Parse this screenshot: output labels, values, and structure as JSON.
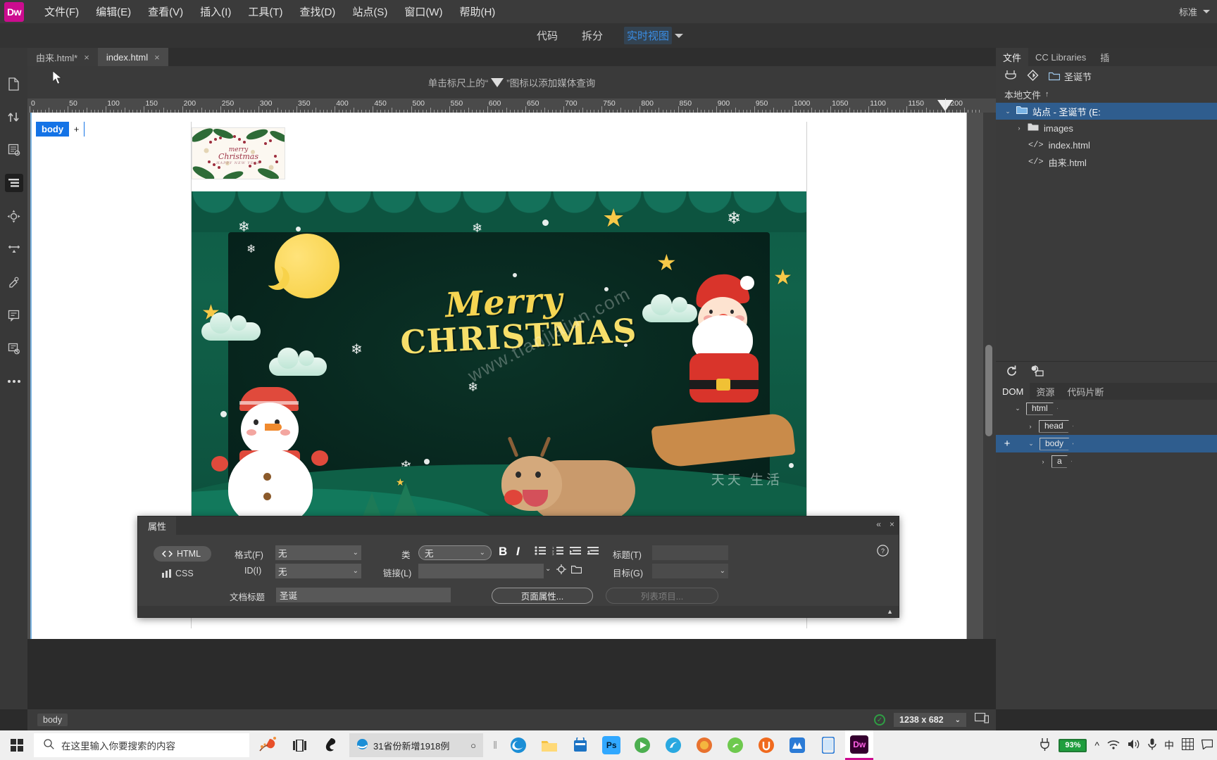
{
  "app": {
    "logo_text": "Dw",
    "workspace_label": "标准"
  },
  "menu": {
    "items": [
      {
        "label": "文件(F)"
      },
      {
        "label": "编辑(E)"
      },
      {
        "label": "查看(V)"
      },
      {
        "label": "插入(I)"
      },
      {
        "label": "工具(T)"
      },
      {
        "label": "查找(D)"
      },
      {
        "label": "站点(S)"
      },
      {
        "label": "窗口(W)"
      },
      {
        "label": "帮助(H)"
      }
    ]
  },
  "viewbar": {
    "code": "代码",
    "split": "拆分",
    "live": "实时视图"
  },
  "tabs": [
    {
      "label": "由来.html*",
      "active": false
    },
    {
      "label": "index.html",
      "active": true
    }
  ],
  "media_query_hint": {
    "before": "单击标尺上的“",
    "after": "”图标以添加媒体查询"
  },
  "ruler": {
    "labels": [
      "0",
      "50",
      "100",
      "150",
      "200",
      "250",
      "300",
      "350",
      "400",
      "450",
      "500",
      "550",
      "600",
      "650",
      "700",
      "750",
      "800",
      "850",
      "900",
      "950",
      "1000",
      "1050",
      "1100",
      "1150",
      "1200"
    ],
    "marker_position_label": "1200"
  },
  "canvas": {
    "body_badge": "body",
    "body_badge_plus": "+",
    "banner": {
      "title": "merry",
      "subtitle": "Christmas",
      "small": "HAPPY NEW YEAR"
    },
    "hero": {
      "merry": "Merry",
      "christmas": "CHRISTMAS",
      "watermark": "www.tianjiajun.com",
      "watermark2": "天天 生活"
    }
  },
  "properties": {
    "panel_title": "属性",
    "html_tab": "HTML",
    "css_tab": "CSS",
    "format_label": "格式(F)",
    "format_value": "无",
    "id_label": "ID(I)",
    "id_value": "无",
    "class_label": "类",
    "class_value": "无",
    "link_label": "链接(L)",
    "link_value": "",
    "title_label": "标题(T)",
    "title_value": "",
    "target_label": "目标(G)",
    "target_value": "",
    "bold": "B",
    "italic": "I",
    "doc_title_label": "文档标题",
    "doc_title_value": "圣诞",
    "page_properties_button": "页面属性...",
    "list_item_button": "列表项目...",
    "help_icon": "?",
    "collapse_icon": "«",
    "close_icon": "×"
  },
  "statusbar": {
    "tag": "body",
    "size": "1238 x 682"
  },
  "right_dock": {
    "tabs": [
      {
        "label": "文件",
        "active": true
      },
      {
        "label": "CC Libraries",
        "active": false
      },
      {
        "label": "插",
        "active": false
      }
    ],
    "site_name": "圣诞节",
    "local_files_label": "本地文件",
    "files": [
      {
        "label": "站点 - 圣诞节 (E:",
        "type": "folder",
        "selected": true,
        "indent": 0,
        "expanded": true
      },
      {
        "label": "images",
        "type": "folder",
        "selected": false,
        "indent": 1,
        "expanded": false
      },
      {
        "label": "index.html",
        "type": "code",
        "selected": false,
        "indent": 1
      },
      {
        "label": "由来.html",
        "type": "code",
        "selected": false,
        "indent": 1
      }
    ],
    "dom": {
      "tabs": [
        {
          "label": "DOM",
          "active": true
        },
        {
          "label": "资源",
          "active": false
        },
        {
          "label": "代码片断",
          "active": false
        }
      ],
      "nodes": [
        {
          "tag": "html",
          "indent": 0,
          "expanded": true,
          "selected": false
        },
        {
          "tag": "head",
          "indent": 1,
          "expanded": false,
          "selected": false
        },
        {
          "tag": "body",
          "indent": 1,
          "expanded": true,
          "selected": true,
          "has_plus": true
        },
        {
          "tag": "a",
          "indent": 2,
          "expanded": false,
          "selected": false
        }
      ]
    }
  },
  "taskbar": {
    "search_placeholder": "在这里输入你要搜索的内容",
    "active_task": "31省份新增1918例",
    "battery": "93%",
    "ime": "中"
  },
  "colors": {
    "accent_blue": "#1473e6",
    "live_view_blue": "#3a8ee6",
    "dw_magenta": "#cc0c8f",
    "panel_bg": "#3b3b3b",
    "select_blue": "#2f5d8e",
    "battery_green": "#1f9e3e"
  }
}
